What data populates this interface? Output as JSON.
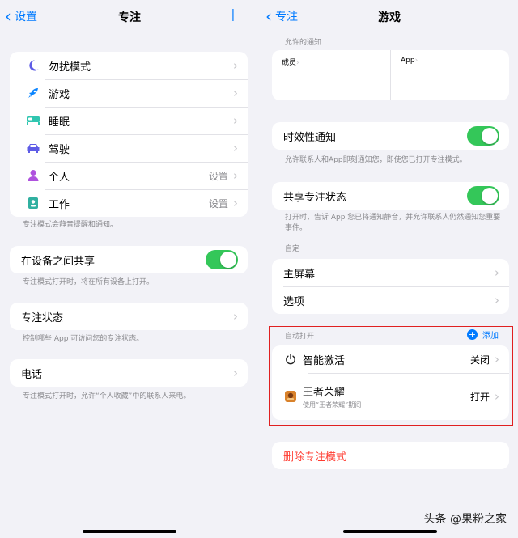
{
  "left": {
    "nav": {
      "back": "设置",
      "title": "专注",
      "plus": "+"
    },
    "modes": [
      {
        "label": "勿扰模式",
        "value": "",
        "icon": "moon-icon",
        "color": "#5e5ce6"
      },
      {
        "label": "游戏",
        "value": "",
        "icon": "rocket-icon",
        "color": "#0a84ff"
      },
      {
        "label": "睡眠",
        "value": "",
        "icon": "bed-icon",
        "color": "#30c6b0"
      },
      {
        "label": "驾驶",
        "value": "",
        "icon": "car-icon",
        "color": "#5e5ce6"
      },
      {
        "label": "个人",
        "value": "设置",
        "icon": "person-icon",
        "color": "#af52de"
      },
      {
        "label": "工作",
        "value": "设置",
        "icon": "badge-icon",
        "color": "#30b0a0"
      }
    ],
    "modes_note": "专注模式会静音提醒和通知。",
    "share": {
      "label": "在设备之间共享",
      "note": "专注模式打开时，将在所有设备上打开。"
    },
    "status": {
      "label": "专注状态",
      "note": "控制哪些 App 可访问您的专注状态。"
    },
    "phone": {
      "label": "电话",
      "note": "专注模式打开时，允许“个人收藏”中的联系人来电。"
    }
  },
  "right": {
    "nav": {
      "back": "专注",
      "title": "游戏"
    },
    "allowed_header": "允许的通知",
    "allowed": {
      "people": "成员",
      "apps": "App",
      "chevron": "›"
    },
    "time_sensitive": {
      "label": "时效性通知",
      "note": "允许联系人和App即刻通知您，即使您已打开专注模式。"
    },
    "share_status": {
      "label": "共享专注状态",
      "note": "打开时，告诉 App 您已将通知静音，并允许联系人仍然通知您重要事件。"
    },
    "custom_header": "自定",
    "custom": [
      {
        "label": "主屏幕"
      },
      {
        "label": "选项"
      }
    ],
    "auto_header": "自动打开",
    "add_label": "添加",
    "auto": {
      "smart": {
        "label": "智能激活",
        "value": "关闭"
      },
      "app": {
        "label": "王者荣耀",
        "sub": "使用“王者荣耀”期间",
        "value": "打开"
      }
    },
    "delete_label": "删除专注模式"
  },
  "chevron": "›",
  "watermark": "头条 @果粉之家",
  "colors": {
    "accent": "#007aff",
    "toggle_on": "#34c759",
    "destructive": "#ff3b30",
    "highlight_box": "#e02020"
  }
}
